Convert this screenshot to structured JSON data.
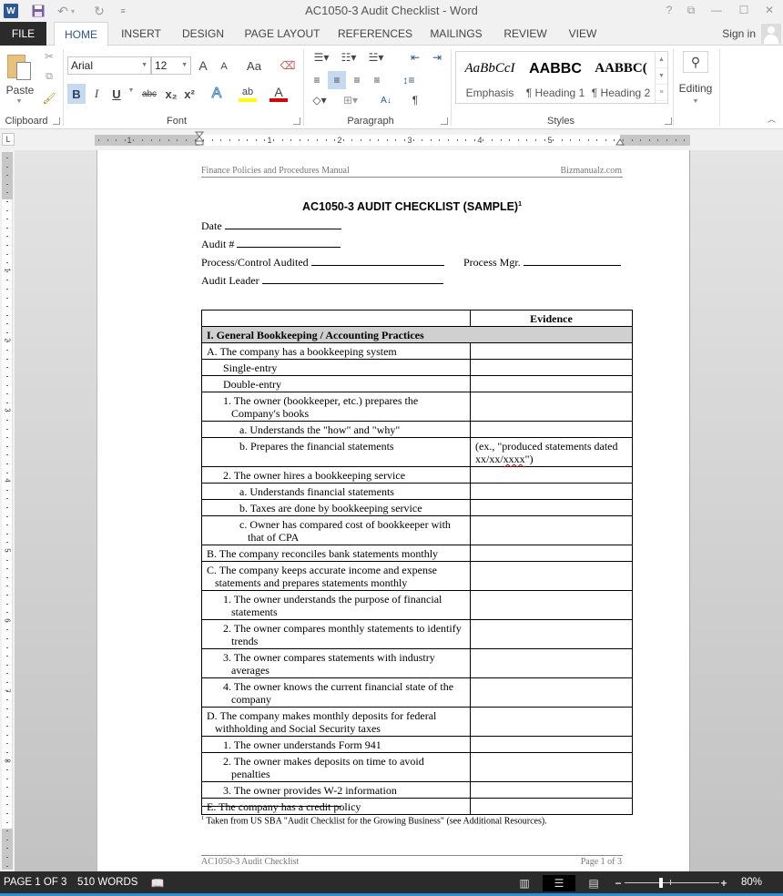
{
  "app": {
    "window_title": "AC1050-3 Audit Checklist - Word",
    "quick_access": {
      "app_icon": "word-icon",
      "save": "save-icon",
      "undo": "undo-icon",
      "redo": "redo-icon",
      "customize": "customize-quick-access-icon"
    },
    "window_controls": [
      "?",
      "⧉",
      "—",
      "☐",
      "✕"
    ]
  },
  "tabs": [
    {
      "label": "FILE",
      "active": false
    },
    {
      "label": "HOME",
      "active": true
    },
    {
      "label": "INSERT",
      "active": false
    },
    {
      "label": "DESIGN",
      "active": false
    },
    {
      "label": "PAGE LAYOUT",
      "active": false
    },
    {
      "label": "REFERENCES",
      "active": false
    },
    {
      "label": "MAILINGS",
      "active": false
    },
    {
      "label": "REVIEW",
      "active": false
    },
    {
      "label": "VIEW",
      "active": false
    }
  ],
  "account": {
    "sign_in": "Sign in"
  },
  "ribbon": {
    "clipboard": {
      "label": "Clipboard",
      "paste": "Paste"
    },
    "font": {
      "label": "Font",
      "font_name": "Arial",
      "font_size": "12",
      "grow": "A",
      "shrink": "A",
      "change_case": "Aa",
      "bold": "B",
      "italic": "I",
      "underline": "U",
      "strikethrough": "abc",
      "subscript": "x₂",
      "superscript": "x²",
      "text_effects": "A",
      "highlight": "ab",
      "font_color": "A",
      "highlight_color": "#ffff00",
      "font_color_value": "#e00000"
    },
    "paragraph": {
      "label": "Paragraph"
    },
    "styles": {
      "label": "Styles",
      "items": [
        {
          "preview": "AaBbCcI",
          "name": "Emphasis"
        },
        {
          "preview": "AABBC",
          "name": "¶ Heading 1"
        },
        {
          "preview": "AABBC(",
          "name": "¶ Heading 2"
        }
      ]
    },
    "editing": {
      "label": "Editing"
    }
  },
  "ruler": {
    "numbers": [
      "1",
      "1",
      "2",
      "3",
      "4",
      "5"
    ],
    "vertical_numbers": [
      "1",
      "2",
      "3",
      "4",
      "5",
      "6",
      "7",
      "8"
    ]
  },
  "document": {
    "header_left": "Finance Policies and Procedures Manual",
    "header_right": "Bizmanualz.com",
    "title": "AC1050-3 AUDIT CHECKLIST (SAMPLE)",
    "title_footnote_ref": "1",
    "fields": {
      "date": "Date",
      "audit_no": "Audit #",
      "process_control": "Process/Control Audited",
      "process_mgr": "Process Mgr.",
      "audit_leader": "Audit Leader"
    },
    "table": {
      "header_col2": "Evidence",
      "section": "I. General Bookkeeping / Accounting Practices",
      "rows": [
        {
          "level": "l0",
          "text": "A. The company has a bookkeeping system",
          "evidence": ""
        },
        {
          "level": "l0b",
          "text": "Single-entry",
          "evidence": ""
        },
        {
          "level": "l0b",
          "text": "Double-entry",
          "evidence": ""
        },
        {
          "level": "l1",
          "text": "1. The owner (bookkeeper, etc.) prepares the Company's books",
          "evidence": ""
        },
        {
          "level": "l2",
          "text": "a. Understands the \"how\" and \"why\"",
          "evidence": ""
        },
        {
          "level": "l2",
          "text": "b. Prepares the financial statements",
          "evidence": "(ex., \"produced statements dated xx/xx/xxxx\")"
        },
        {
          "level": "l1",
          "text": "2. The owner hires a bookkeeping service",
          "evidence": ""
        },
        {
          "level": "l2",
          "text": "a. Understands financial statements",
          "evidence": ""
        },
        {
          "level": "l2",
          "text": "b. Taxes are done by bookkeeping service",
          "evidence": ""
        },
        {
          "level": "l2",
          "text": "c. Owner has compared cost of bookkeeper with that of CPA",
          "evidence": ""
        },
        {
          "level": "l0",
          "text": "B. The company reconciles bank statements monthly",
          "evidence": ""
        },
        {
          "level": "l0",
          "text": "C. The company keeps accurate income and expense statements and prepares statements monthly",
          "evidence": ""
        },
        {
          "level": "l1",
          "text": "1. The owner understands the purpose of financial statements",
          "evidence": ""
        },
        {
          "level": "l1",
          "text": "2. The owner compares monthly statements to identify trends",
          "evidence": ""
        },
        {
          "level": "l1",
          "text": "3. The owner compares statements with industry averages",
          "evidence": ""
        },
        {
          "level": "l1",
          "text": "4. The owner knows the current financial state of the company",
          "evidence": ""
        },
        {
          "level": "l0",
          "text": "D. The company makes monthly deposits for federal withholding and Social Security taxes",
          "evidence": ""
        },
        {
          "level": "l1",
          "text": "1. The owner understands Form 941",
          "evidence": ""
        },
        {
          "level": "l1",
          "text": "2. The owner makes deposits on time to avoid penalties",
          "evidence": ""
        },
        {
          "level": "l1",
          "text": "3. The owner provides W-2 information",
          "evidence": ""
        },
        {
          "level": "l0",
          "text": "E. The company has a credit policy",
          "evidence": ""
        }
      ]
    },
    "footnote_ref": "1",
    "footnote": "Taken from US SBA \"Audit Checklist for the Growing Business\" (see Additional Resources).",
    "footer_left": "AC1050-3 Audit Checklist",
    "footer_right": "Page 1 of 3"
  },
  "status": {
    "page": "PAGE 1 OF 3",
    "words": "510 WORDS",
    "proofing_icon": "proofing-error-icon",
    "zoom": "80%",
    "zoom_percent": 80,
    "active_view": "print-layout"
  }
}
